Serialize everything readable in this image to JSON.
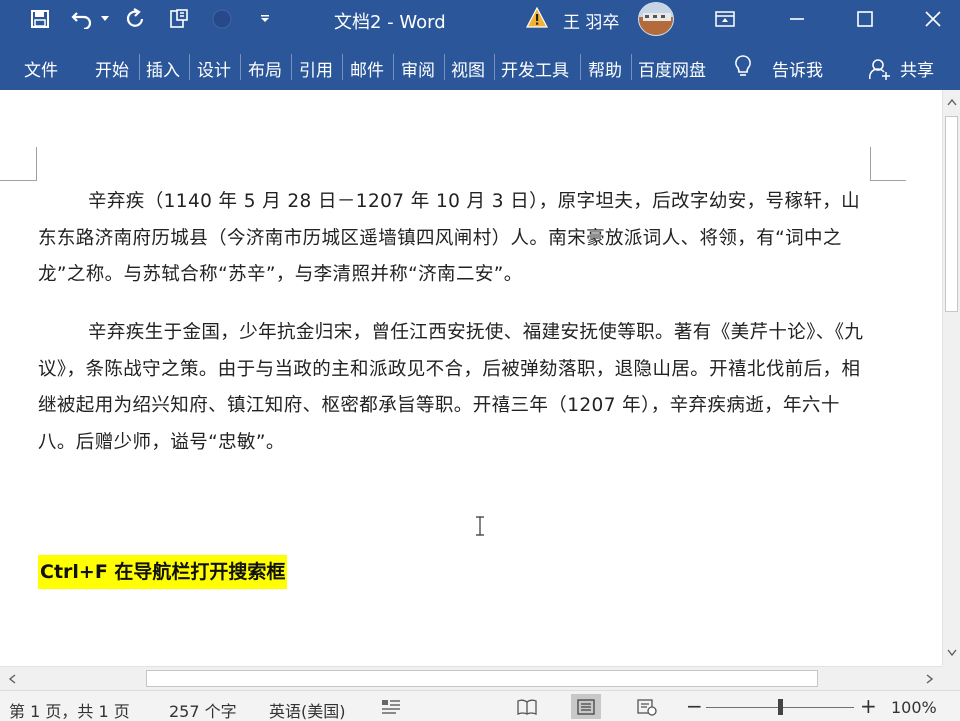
{
  "window": {
    "title": "文档2  -  Word",
    "user_name": "王 羽卒"
  },
  "ribbon": {
    "tabs": [
      "文件",
      "开始",
      "插入",
      "设计",
      "布局",
      "引用",
      "邮件",
      "审阅",
      "视图",
      "开发工具",
      "帮助",
      "百度网盘"
    ],
    "tell_me": "告诉我",
    "share": "共享"
  },
  "document": {
    "paragraphs": [
      "辛弃疾（1140 年 5 月 28 日－1207 年 10 月 3 日），原字坦夫，后改字幼安，号稼轩，山东东路济南府历城县（今济南市历城区遥墙镇四风闸村）人。南宋豪放派词人、将领，有“词中之龙”之称。与苏轼合称“苏辛”，与李清照并称“济南二安”。",
      "辛弃疾生于金国，少年抗金归宋，曾任江西安抚使、福建安抚使等职。著有《美芹十论》、《九议》，条陈战守之策。由于与当政的主和派政见不合，后被弹劾落职，退隐山居。开禧北伐前后，相继被起用为绍兴知府、镇江知府、枢密都承旨等职。开禧三年（1207 年），辛弃疾病逝，年六十八。后赠少师，谥号“忠敏”。"
    ],
    "highlight_text": "Ctrl+F 在导航栏打开搜索框",
    "highlight_color": "#ffff00"
  },
  "status_bar": {
    "page": "第 1 页，共 1 页",
    "word_count": "257 个字",
    "language": "英语(美国)",
    "zoom_minus": "−",
    "zoom_plus": "+",
    "zoom_level": "100%",
    "zoom_fraction": 0.5
  },
  "colors": {
    "brand": "#2b579a"
  }
}
